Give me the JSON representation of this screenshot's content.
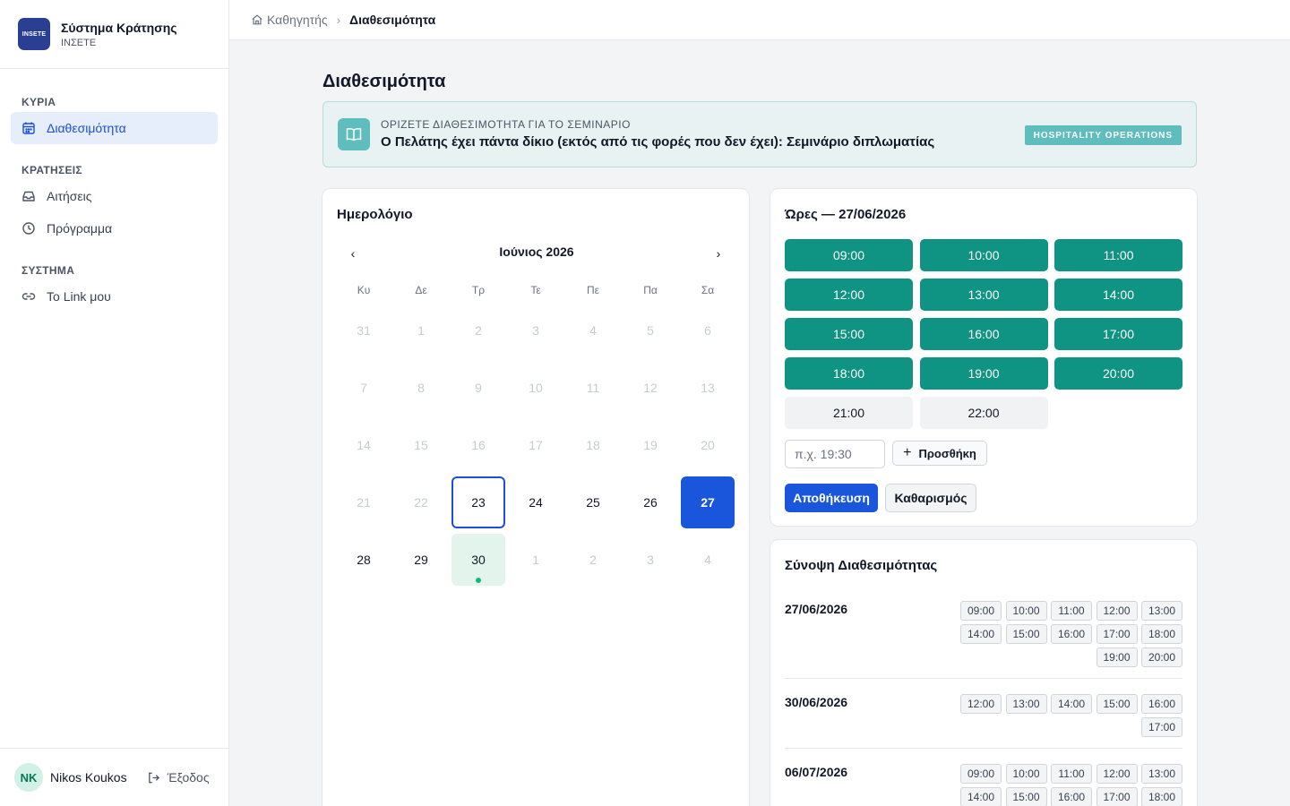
{
  "brand": {
    "logo_text": "INSETE",
    "title": "Σύστημα Κράτησης",
    "subtitle": "ΙΝΣΕΤΕ"
  },
  "sidebar": {
    "sections": [
      {
        "title": "ΚΥΡΙΑ",
        "items": [
          {
            "label": "Διαθεσιμότητα",
            "icon": "calendar-icon",
            "active": true
          }
        ]
      },
      {
        "title": "ΚΡΑΤΗΣΕΙΣ",
        "items": [
          {
            "label": "Αιτήσεις",
            "icon": "inbox-icon"
          },
          {
            "label": "Πρόγραμμα",
            "icon": "clock-icon"
          }
        ]
      },
      {
        "title": "ΣΥΣΤΗΜΑ",
        "items": [
          {
            "label": "Το Link μου",
            "icon": "link-icon"
          }
        ]
      }
    ],
    "user": {
      "initials": "NK",
      "name": "Nikos Koukos"
    },
    "logout_label": "Έξοδος"
  },
  "breadcrumb": {
    "home": "Καθηγητής",
    "current": "Διαθεσιμότητα"
  },
  "page": {
    "title": "Διαθεσιμότητα"
  },
  "banner": {
    "subtitle": "ΟΡΙΖΕΤΕ ΔΙΑΘΕΣΙΜΟΤΗΤΑ ΓΙΑ ΤΟ ΣΕΜΙΝΑΡΙΟ",
    "title": "Ο Πελάτης έχει πάντα δίκιο (εκτός από τις φορές που δεν έχει): Σεμινάριο διπλωματίας",
    "badge": "HOSPITALITY OPERATIONS"
  },
  "calendar": {
    "title": "Ημερολόγιο",
    "month_label": "Ιούνιος 2026",
    "prev_glyph": "‹",
    "next_glyph": "›",
    "weekdays": [
      "Κυ",
      "Δε",
      "Τρ",
      "Τε",
      "Πε",
      "Πα",
      "Σα"
    ],
    "weeks": [
      [
        {
          "d": "31",
          "s": "muted"
        },
        {
          "d": "1",
          "s": "muted"
        },
        {
          "d": "2",
          "s": "muted"
        },
        {
          "d": "3",
          "s": "muted"
        },
        {
          "d": "4",
          "s": "muted"
        },
        {
          "d": "5",
          "s": "muted"
        },
        {
          "d": "6",
          "s": "muted"
        }
      ],
      [
        {
          "d": "7",
          "s": "muted"
        },
        {
          "d": "8",
          "s": "muted"
        },
        {
          "d": "9",
          "s": "muted"
        },
        {
          "d": "10",
          "s": "muted"
        },
        {
          "d": "11",
          "s": "muted"
        },
        {
          "d": "12",
          "s": "muted"
        },
        {
          "d": "13",
          "s": "muted"
        }
      ],
      [
        {
          "d": "14",
          "s": "muted"
        },
        {
          "d": "15",
          "s": "muted"
        },
        {
          "d": "16",
          "s": "muted"
        },
        {
          "d": "17",
          "s": "muted"
        },
        {
          "d": "18",
          "s": "muted"
        },
        {
          "d": "19",
          "s": "muted"
        },
        {
          "d": "20",
          "s": "muted"
        }
      ],
      [
        {
          "d": "21",
          "s": "muted"
        },
        {
          "d": "22",
          "s": "muted"
        },
        {
          "d": "23",
          "s": "today"
        },
        {
          "d": "24",
          "s": "norm"
        },
        {
          "d": "25",
          "s": "norm"
        },
        {
          "d": "26",
          "s": "norm"
        },
        {
          "d": "27",
          "s": "selected"
        }
      ],
      [
        {
          "d": "28",
          "s": "norm"
        },
        {
          "d": "29",
          "s": "norm"
        },
        {
          "d": "30",
          "s": "hasav"
        },
        {
          "d": "1",
          "s": "muted"
        },
        {
          "d": "2",
          "s": "muted"
        },
        {
          "d": "3",
          "s": "muted"
        },
        {
          "d": "4",
          "s": "muted"
        }
      ]
    ]
  },
  "hours": {
    "title": "Ώρες — 27/06/2026",
    "slots": [
      {
        "t": "09:00",
        "on": true
      },
      {
        "t": "10:00",
        "on": true
      },
      {
        "t": "11:00",
        "on": true
      },
      {
        "t": "12:00",
        "on": true
      },
      {
        "t": "13:00",
        "on": true
      },
      {
        "t": "14:00",
        "on": true
      },
      {
        "t": "15:00",
        "on": true
      },
      {
        "t": "16:00",
        "on": true
      },
      {
        "t": "17:00",
        "on": true
      },
      {
        "t": "18:00",
        "on": true
      },
      {
        "t": "19:00",
        "on": true
      },
      {
        "t": "20:00",
        "on": true
      },
      {
        "t": "21:00",
        "on": false
      },
      {
        "t": "22:00",
        "on": false
      }
    ],
    "input_placeholder": "π.χ. 19:30",
    "add_label": "Προσθήκη",
    "save_label": "Αποθήκευση",
    "clear_label": "Καθαρισμός"
  },
  "summary": {
    "title": "Σύνοψη Διαθεσιμότητας",
    "entries": [
      {
        "date": "27/06/2026",
        "times": [
          "09:00",
          "10:00",
          "11:00",
          "12:00",
          "13:00",
          "14:00",
          "15:00",
          "16:00",
          "17:00",
          "18:00",
          "19:00",
          "20:00"
        ]
      },
      {
        "date": "30/06/2026",
        "times": [
          "12:00",
          "13:00",
          "14:00",
          "15:00",
          "16:00",
          "17:00"
        ]
      },
      {
        "date": "06/07/2026",
        "times": [
          "09:00",
          "10:00",
          "11:00",
          "12:00",
          "13:00",
          "14:00",
          "15:00",
          "16:00",
          "17:00",
          "18:00"
        ]
      }
    ]
  },
  "colors": {
    "primary": "#1a56db",
    "teal": "#0f9483",
    "banner_bg": "#e8f2f2",
    "badge": "#5fbdbd"
  }
}
